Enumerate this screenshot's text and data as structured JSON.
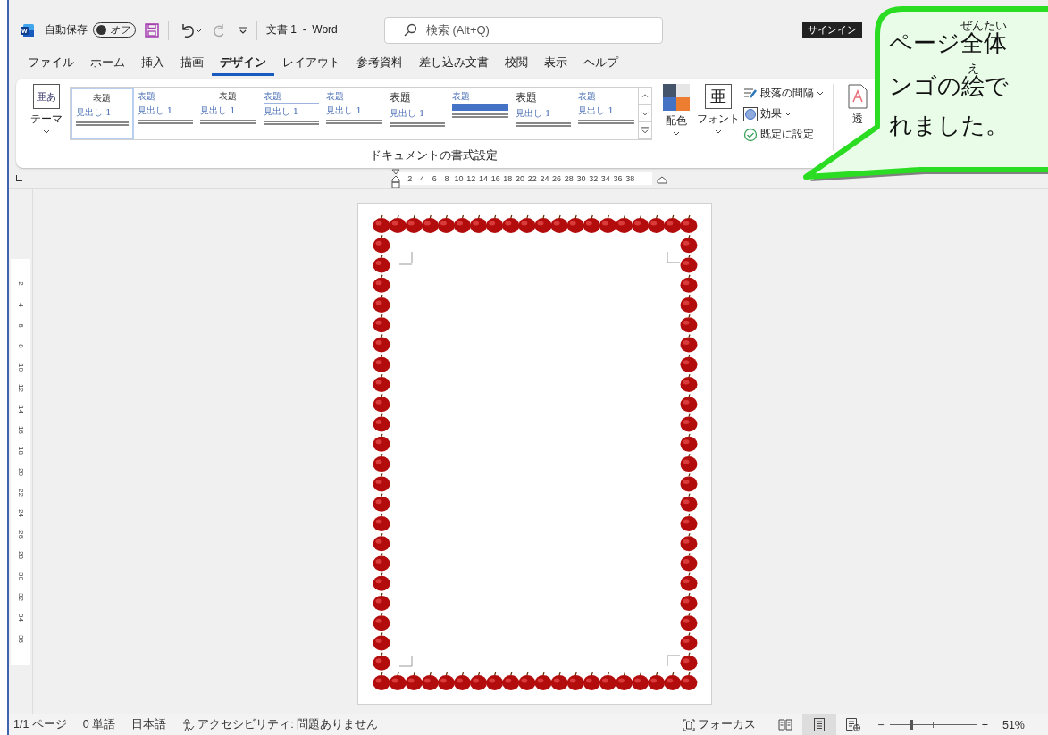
{
  "title_bar": {
    "autosave_label": "自動保存",
    "autosave_on": false,
    "autosave_state": "オフ",
    "document_title": "文書 1  -  Word",
    "search_placeholder": "検索 (Alt+Q)",
    "sign_in": "サインイン"
  },
  "tabs": [
    {
      "label": "ファイル",
      "selected": false
    },
    {
      "label": "ホーム",
      "selected": false
    },
    {
      "label": "挿入",
      "selected": false
    },
    {
      "label": "描画",
      "selected": false
    },
    {
      "label": "デザイン",
      "selected": true
    },
    {
      "label": "レイアウト",
      "selected": false
    },
    {
      "label": "参考資料",
      "selected": false
    },
    {
      "label": "差し込み文書",
      "selected": false
    },
    {
      "label": "校閲",
      "selected": false
    },
    {
      "label": "表示",
      "selected": false
    },
    {
      "label": "ヘルプ",
      "selected": false
    }
  ],
  "ribbon": {
    "theme_glyph": "亜あ",
    "theme": "テーマ",
    "gallery": [
      {
        "title": "表題",
        "heading": "見出し 1",
        "kind": "small",
        "selected": true
      },
      {
        "title": "表題",
        "heading": "見出し 1",
        "kind": "plain",
        "selected": false
      },
      {
        "title": "表題",
        "heading": "見出し 1",
        "kind": "small",
        "selected": false
      },
      {
        "title": "表題",
        "heading": "見出し 1",
        "kind": "rule",
        "selected": false
      },
      {
        "title": "表題",
        "heading": "見出し 1",
        "kind": "plain",
        "selected": false
      },
      {
        "title": "表題",
        "heading": "見出し 1",
        "kind": "large",
        "selected": false
      },
      {
        "title": "表題",
        "kind": "band",
        "selected": false
      },
      {
        "title": "表題",
        "heading": "見出し 1",
        "kind": "large",
        "selected": false
      },
      {
        "title": "表題",
        "heading": "見出し 1",
        "kind": "plain",
        "selected": false
      }
    ],
    "colors": "配色",
    "font_glyph": "亜",
    "fonts": "フォント",
    "paragraph_spacing": "段落の間隔",
    "effects": "効果",
    "set_default": "既定に設定",
    "watermark": "透",
    "group_label": "ドキュメントの書式設定"
  },
  "ruler": {
    "horizontal": [
      "2",
      "4",
      "6",
      "8",
      "10",
      "12",
      "14",
      "16",
      "18",
      "20",
      "22",
      "24",
      "26",
      "28",
      "30",
      "32",
      "34",
      "36",
      "38"
    ],
    "vertical": [
      "2",
      "4",
      "6",
      "8",
      "10",
      "12",
      "14",
      "16",
      "18",
      "20",
      "22",
      "24",
      "26",
      "28",
      "30",
      "32",
      "34",
      "36"
    ]
  },
  "callout": {
    "lines": [
      [
        {
          "text": "ページ"
        },
        {
          "text": "全体",
          "ruby": "ぜんたい"
        }
      ],
      [
        {
          "text": "ンゴの"
        },
        {
          "text": "絵",
          "ruby": "え"
        },
        {
          "text": "で"
        }
      ],
      [
        {
          "text": "れました。"
        }
      ]
    ]
  },
  "status_bar": {
    "page": "1/1 ページ",
    "words": "0 単語",
    "language": "日本語",
    "accessibility": "アクセシビリティ: 問題ありません",
    "focus": "フォーカス",
    "views": [
      {
        "kind": "read",
        "selected": false
      },
      {
        "kind": "print",
        "selected": true
      },
      {
        "kind": "web",
        "selected": false
      }
    ],
    "zoom_minus": "−",
    "zoom_plus": "+",
    "zoom": {
      "level": 0.25
    },
    "zoom_percent": "51%"
  }
}
